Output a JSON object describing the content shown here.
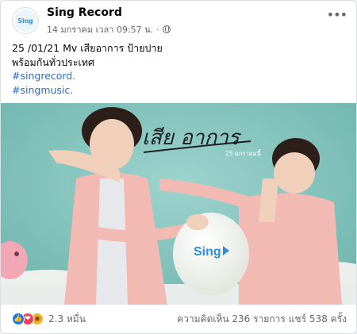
{
  "post": {
    "page_name": "Sing Record",
    "avatar_text": "Sing",
    "timestamp": "14 มกราคม เวลา 09:57 น.",
    "dot": "·",
    "caption_lines": [
      "25 /01/21  Mv เสียอาการ ป้ายปาย",
      "พร้อมกันทั่วประเทศ"
    ],
    "hashtags": [
      "#singrecord.",
      "#singmusic."
    ],
    "more_icon": "•••"
  },
  "image": {
    "title_script": "เสีย อาการ",
    "date_text": "25 มกราคมนี้",
    "balloon_logo": "Sing"
  },
  "footer": {
    "reaction_icons": [
      "like-icon",
      "love-icon",
      "wow-icon"
    ],
    "reactions_count": "2.3 หมื่น",
    "comments": "ความคิดเห็น 236 รายการ",
    "shares": "แชร์ 538 ครั้ง"
  },
  "colors": {
    "hashtag": "#216fdb",
    "background": "#7fc3bc",
    "shirt": "#f2b9b3"
  }
}
